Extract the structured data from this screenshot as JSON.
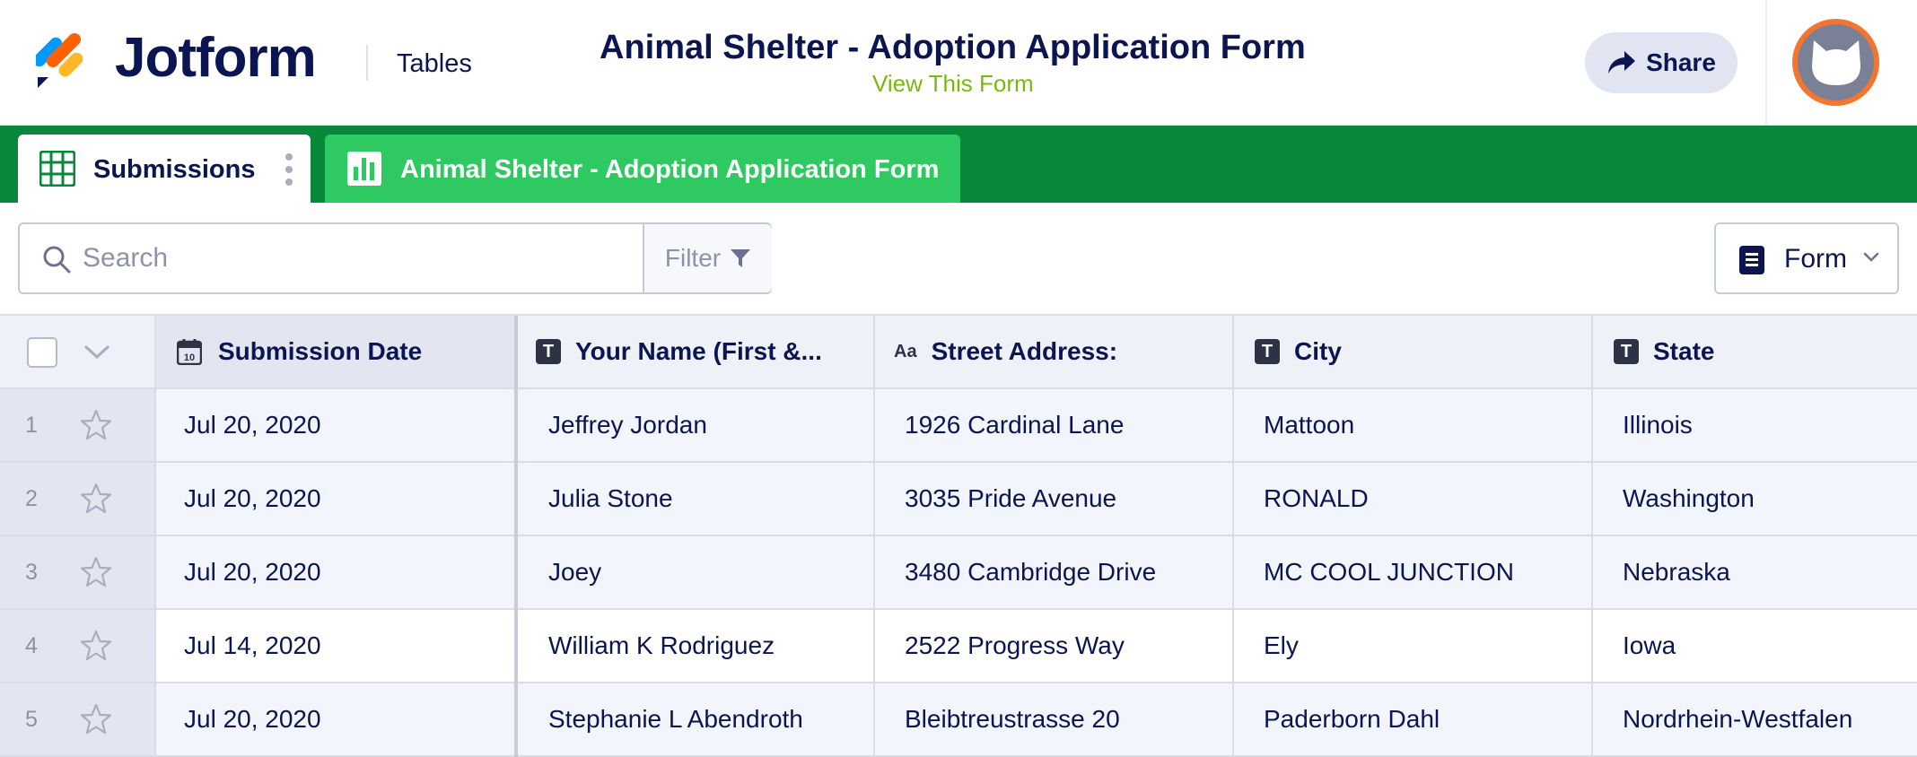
{
  "header": {
    "brand": "Jotform",
    "section": "Tables",
    "form_title": "Animal Shelter - Adoption Application Form",
    "view_link": "View This Form",
    "share_label": "Share"
  },
  "tabs": [
    {
      "label": "Submissions"
    },
    {
      "label": "Animal Shelter - Adoption Application Form"
    }
  ],
  "toolbar": {
    "search_placeholder": "Search",
    "filter_label": "Filter",
    "view_label": "Form"
  },
  "table": {
    "columns": [
      "Submission Date",
      "Your Name (First &...",
      "Street Address:",
      "City",
      "State"
    ],
    "rows": [
      {
        "num": "1",
        "date": "Jul 20, 2020",
        "name": "Jeffrey Jordan",
        "street": "1926 Cardinal Lane",
        "city": "Mattoon",
        "state": "Illinois"
      },
      {
        "num": "2",
        "date": "Jul 20, 2020",
        "name": "Julia Stone",
        "street": "3035 Pride Avenue",
        "city": "RONALD",
        "state": "Washington"
      },
      {
        "num": "3",
        "date": "Jul 20, 2020",
        "name": "Joey",
        "street": "3480 Cambridge Drive",
        "city": "MC COOL JUNCTION",
        "state": "Nebraska"
      },
      {
        "num": "4",
        "date": "Jul 14, 2020",
        "name": "William K Rodriguez",
        "street": "2522 Progress Way",
        "city": "Ely",
        "state": "Iowa"
      },
      {
        "num": "5",
        "date": "Jul 20, 2020",
        "name": "Stephanie L Abendroth",
        "street": "Bleibtreustrasse 20",
        "city": "Paderborn Dahl",
        "state": "Nordrhein-Westfalen"
      }
    ]
  },
  "icons": {
    "logo": "jotform-logo-icon",
    "share": "share-arrow-icon",
    "avatar": "cat-avatar-icon",
    "submissions_tab": "grid-table-icon",
    "form_tab": "report-bars-icon",
    "search": "search-icon",
    "filter": "funnel-icon",
    "form_view": "document-icon",
    "calendar": "calendar-icon",
    "text_field": "text-t-icon",
    "address_field": "aa-icon",
    "pin": "pin-icon",
    "star": "star-icon"
  },
  "colors": {
    "brand_navy": "#0a1551",
    "tabbar_green": "#09873a",
    "form_tab_green": "#2ec960",
    "view_link_green": "#78bb07",
    "avatar_orange": "#f37630"
  }
}
